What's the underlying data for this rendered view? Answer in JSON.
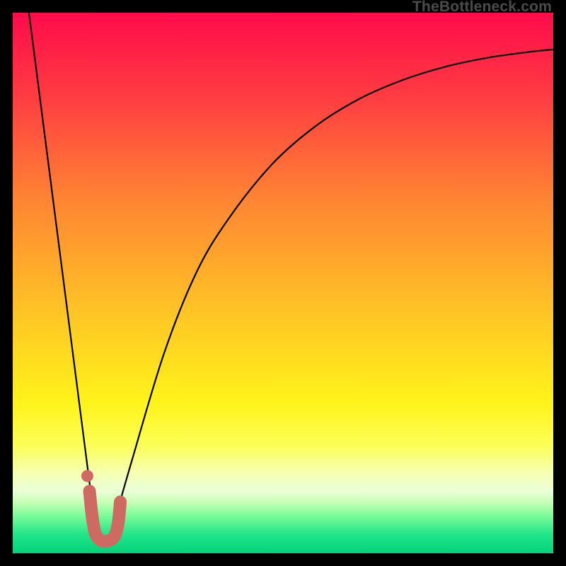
{
  "watermark": "TheBottleneck.com",
  "chart_data": {
    "type": "line",
    "title": "",
    "xlabel": "",
    "ylabel": "",
    "xlim": [
      0,
      100
    ],
    "ylim": [
      0,
      100
    ],
    "grid": false,
    "series": [
      {
        "name": "left-descent",
        "x": [
          3,
          15.5
        ],
        "y": [
          100,
          3
        ],
        "stroke": "#000000",
        "style": "line"
      },
      {
        "name": "right-curve",
        "x": [
          18,
          22,
          28,
          34,
          40,
          48,
          56,
          64,
          72,
          80,
          88,
          96,
          100
        ],
        "y": [
          3,
          17,
          37,
          52,
          62,
          72,
          79,
          84,
          87.5,
          90,
          91.7,
          92.8,
          93.2
        ],
        "stroke": "#000000",
        "style": "curve"
      },
      {
        "name": "valley-marker",
        "x": [
          14.2,
          14.7,
          15.3,
          16.4,
          17.6,
          18.8,
          19.5,
          19.9
        ],
        "y": [
          11.5,
          6.8,
          3.6,
          2.3,
          2.3,
          3.1,
          5.5,
          9.5
        ],
        "stroke": "#cf6a63",
        "style": "thick-curve"
      },
      {
        "name": "valley-dot",
        "x": [
          13.8
        ],
        "y": [
          14.3
        ],
        "stroke": "#cf6a63",
        "style": "dot"
      }
    ],
    "background_gradient": {
      "type": "vertical",
      "stops": [
        {
          "pos": 0.0,
          "color": "#ff0b4a"
        },
        {
          "pos": 0.15,
          "color": "#ff3a42"
        },
        {
          "pos": 0.35,
          "color": "#ff8633"
        },
        {
          "pos": 0.55,
          "color": "#ffc326"
        },
        {
          "pos": 0.72,
          "color": "#fff31a"
        },
        {
          "pos": 0.8,
          "color": "#fbff56"
        },
        {
          "pos": 0.85,
          "color": "#f6ffb0"
        },
        {
          "pos": 0.885,
          "color": "#eaffd7"
        },
        {
          "pos": 0.905,
          "color": "#c8ffb7"
        },
        {
          "pos": 0.93,
          "color": "#7dfc9a"
        },
        {
          "pos": 0.965,
          "color": "#22e589"
        },
        {
          "pos": 1.0,
          "color": "#03d27a"
        }
      ]
    }
  }
}
